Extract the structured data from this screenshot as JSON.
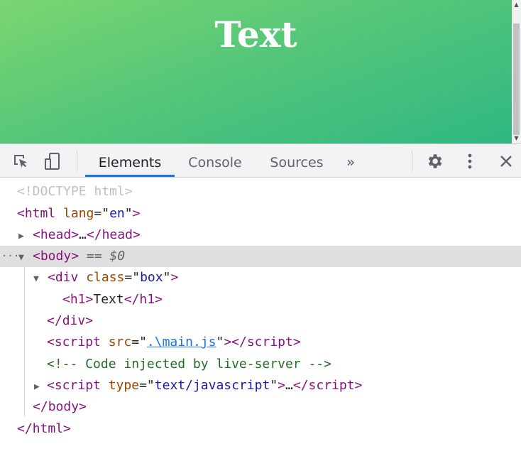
{
  "page": {
    "heading": "Text"
  },
  "scrollbar": {
    "up_arrow": "▲",
    "down_arrow": "▼"
  },
  "devtools": {
    "tabs": [
      "Elements",
      "Console",
      "Sources"
    ],
    "more_tabs": "»",
    "active_tab": "Elements"
  },
  "tree": {
    "doctype": "<!DOCTYPE html>",
    "html_open": {
      "tag": "html",
      "attr": "lang",
      "value": "en"
    },
    "head": {
      "tag": "head",
      "ellipsis": "…"
    },
    "body": {
      "tag": "body",
      "selected_marker": "== $0",
      "dots": "···"
    },
    "div": {
      "tag": "div",
      "attr": "class",
      "value": "box"
    },
    "h1": {
      "tag": "h1",
      "text": "Text"
    },
    "div_close": "div",
    "script1": {
      "tag": "script",
      "attr": "src",
      "value": ".\\main.js"
    },
    "comment": "<!-- Code injected by live-server -->",
    "script2": {
      "tag": "script",
      "attr": "type",
      "value": "text/javascript",
      "ellipsis": "…"
    },
    "body_close": "body",
    "html_close": "html"
  },
  "colors": {
    "tag": "#881280",
    "attribute": "#994500",
    "value": "#1a1aa6",
    "comment": "#236e25",
    "active_tab_underline": "#1a73e8",
    "selection": "#dfdfdf"
  },
  "icons": [
    "inspect-icon",
    "device-toggle-icon",
    "gear-icon",
    "kebab-menu-icon",
    "close-icon"
  ]
}
